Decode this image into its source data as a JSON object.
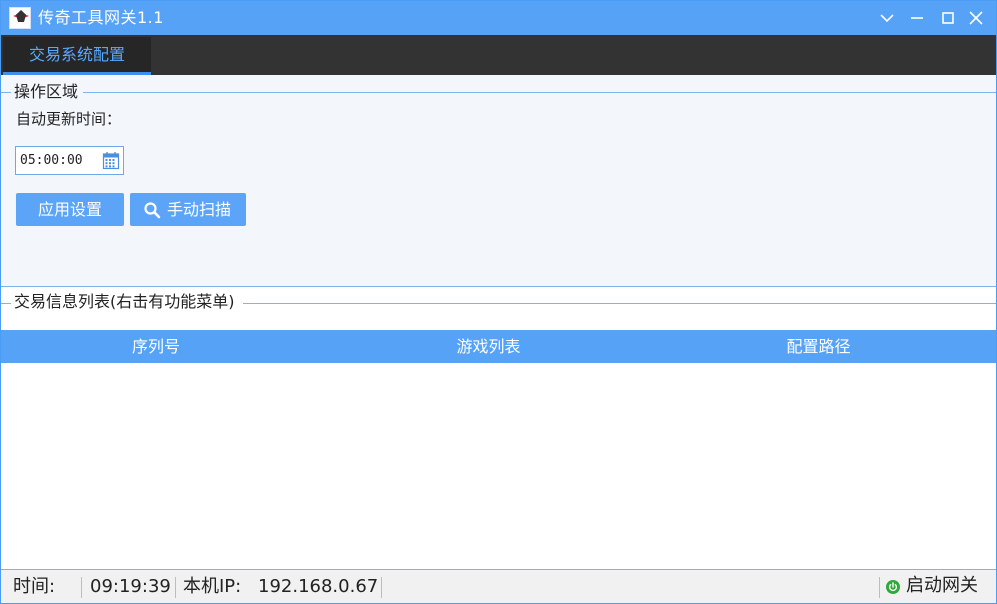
{
  "window": {
    "title": "传奇工具网关1.1",
    "accent": "#55a2f7"
  },
  "tabs": [
    {
      "label": "交易系统配置",
      "active": true
    }
  ],
  "ops": {
    "group_title": "操作区域",
    "update_label": "自动更新时间：",
    "time_value": "05:00:00",
    "apply_label": "应用设置",
    "scan_label": "手动扫描"
  },
  "list": {
    "group_title": "交易信息列表(右击有功能菜单)",
    "columns": [
      "序列号",
      "游戏列表",
      "配置路径"
    ]
  },
  "status": {
    "time_label": "时间:",
    "time_value": "09:19:39",
    "ip_label": "本机IP:",
    "ip_value": "192.168.0.67",
    "start_label": "启动网关",
    "start_color": "#2eaa3a"
  },
  "icons": {
    "app": "app-logo-icon",
    "calendar": "calendar-icon",
    "search": "search-icon",
    "power": "power-icon"
  }
}
